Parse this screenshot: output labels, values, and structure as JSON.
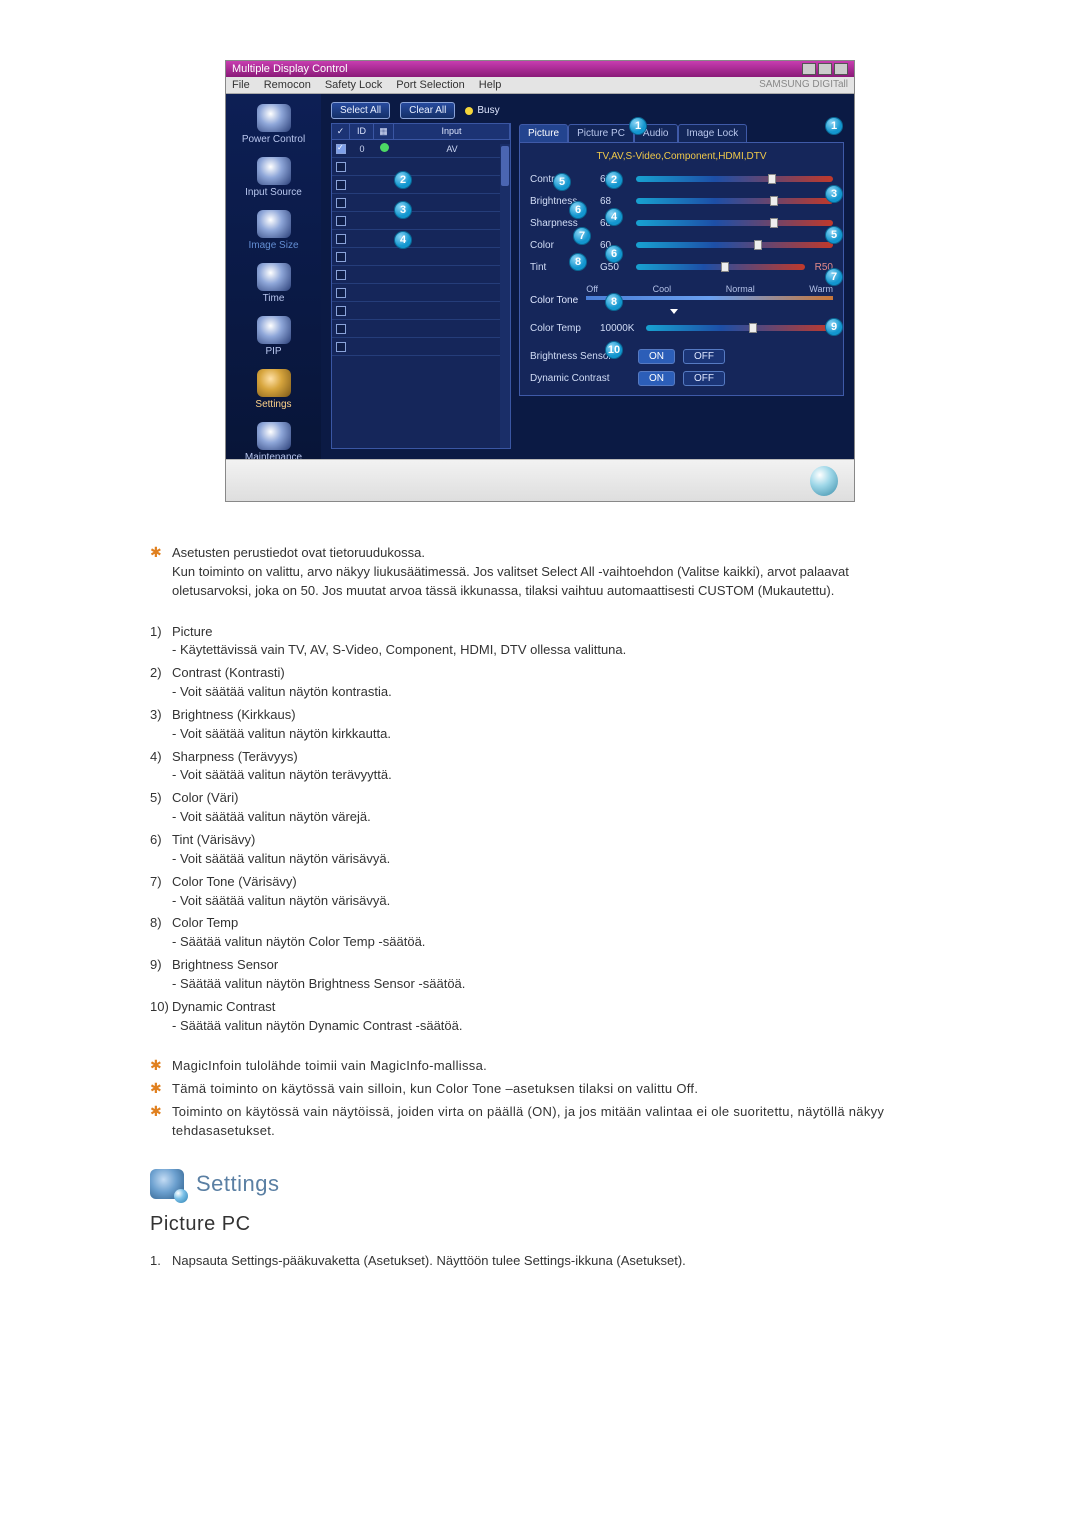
{
  "window": {
    "title": "Multiple Display Control"
  },
  "menu": {
    "file": "File",
    "remocon": "Remocon",
    "safety": "Safety Lock",
    "port": "Port Selection",
    "help": "Help",
    "brand": "SAMSUNG DIGITall"
  },
  "sidebar": {
    "power": "Power Control",
    "input": "Input Source",
    "image": "Image Size",
    "time": "Time",
    "pip": "PIP",
    "settings": "Settings",
    "maint": "Maintenance"
  },
  "buttons": {
    "select_all": "Select All",
    "clear_all": "Clear All",
    "busy": "Busy"
  },
  "grid": {
    "hdr_id": "ID",
    "hdr_input": "Input",
    "row0_id": "0",
    "row0_in": "AV"
  },
  "tabs": {
    "picture": "Picture",
    "picture_pc": "Picture PC",
    "audio": "Audio",
    "image_lock": "Image Lock"
  },
  "panel": {
    "sub": "TV,AV,S-Video,Component,HDMI,DTV",
    "contrast": "Contrast",
    "contrast_v": "67",
    "brightness": "Brightness",
    "brightness_v": "68",
    "sharpness": "Sharpness",
    "sharpness_v": "68",
    "color": "Color",
    "color_v": "60",
    "tint": "Tint",
    "tint_g": "G50",
    "tint_r": "R50",
    "colortone": "Color Tone",
    "ct_off": "Off",
    "ct_cool": "Cool",
    "ct_normal": "Normal",
    "ct_warm": "Warm",
    "colortemp": "Color Temp",
    "colortemp_v": "10000K",
    "bsensor": "Brightness Sensor",
    "dcontrast": "Dynamic Contrast",
    "on": "ON",
    "off": "OFF"
  },
  "doc": {
    "star1_l1": "Asetusten perustiedot ovat tietoruudukossa.",
    "star1_l2": "Kun toiminto on valittu, arvo näkyy liukusäätimessä. Jos valitset Select All -vaihtoehdon (Valitse kaikki), arvot palaavat oletusarvoksi, joka on 50. Jos muutat arvoa tässä ikkunassa, tilaksi vaihtuu automaattisesti CUSTOM (Mukautettu).",
    "i1_t": "Picture",
    "i1_s": "- Käytettävissä vain TV, AV, S-Video, Component, HDMI, DTV ollessa valittuna.",
    "i2_t": "Contrast (Kontrasti)",
    "i2_s": "- Voit säätää valitun näytön kontrastia.",
    "i3_t": "Brightness (Kirkkaus)",
    "i3_s": "- Voit säätää valitun näytön kirkkautta.",
    "i4_t": "Sharpness (Terävyys)",
    "i4_s": "- Voit säätää valitun näytön terävyyttä.",
    "i5_t": "Color (Väri)",
    "i5_s": "- Voit säätää valitun näytön värejä.",
    "i6_t": "Tint (Värisävy)",
    "i6_s": "- Voit säätää valitun näytön värisävyä.",
    "i7_t": "Color Tone (Värisävy)",
    "i7_s": "- Voit säätää valitun näytön värisävyä.",
    "i8_t": "Color Temp",
    "i8_s": "- Säätää valitun näytön Color Temp -säätöä.",
    "i9_t": "Brightness Sensor",
    "i9_s": "- Säätää valitun näytön Brightness Sensor -säätöä.",
    "i10_t": "Dynamic Contrast",
    "i10_s": "- Säätää valitun näytön Dynamic Contrast -säätöä.",
    "note1": "MagicInfoin tulolähde toimii vain MagicInfo-mallissa.",
    "note2": "Tämä toiminto on käytössä vain silloin, kun Color Tone –asetuksen tilaksi on valittu Off.",
    "note3": "Toiminto on käytössä vain näytöissä, joiden virta on päällä (ON), ja jos mitään valintaa ei ole suoritettu, näytöllä näkyy tehdasasetukset.",
    "section": "Settings",
    "subhead": "Picture PC",
    "pc1": "Napsauta Settings-pääkuvaketta (Asetukset). Näyttöön tulee Settings-ikkuna (Asetukset)."
  }
}
